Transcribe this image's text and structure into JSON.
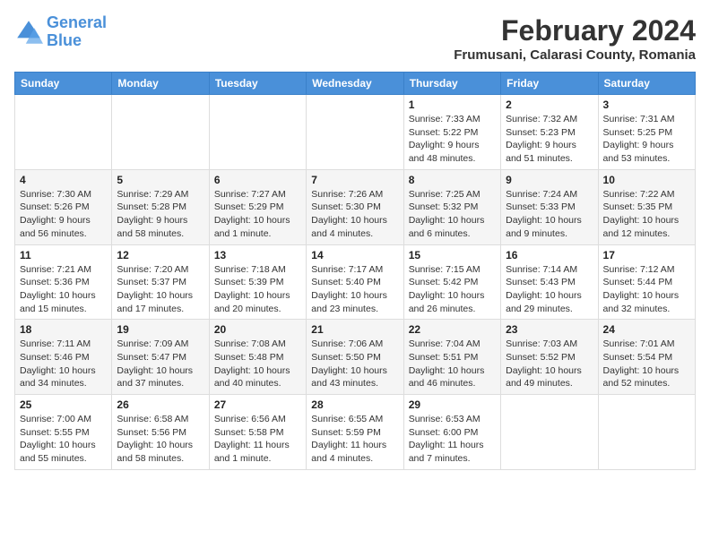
{
  "logo": {
    "line1": "General",
    "line2": "Blue"
  },
  "title": "February 2024",
  "subtitle": "Frumusani, Calarasi County, Romania",
  "days_header": [
    "Sunday",
    "Monday",
    "Tuesday",
    "Wednesday",
    "Thursday",
    "Friday",
    "Saturday"
  ],
  "weeks": [
    [
      {
        "num": "",
        "info": ""
      },
      {
        "num": "",
        "info": ""
      },
      {
        "num": "",
        "info": ""
      },
      {
        "num": "",
        "info": ""
      },
      {
        "num": "1",
        "info": "Sunrise: 7:33 AM\nSunset: 5:22 PM\nDaylight: 9 hours\nand 48 minutes."
      },
      {
        "num": "2",
        "info": "Sunrise: 7:32 AM\nSunset: 5:23 PM\nDaylight: 9 hours\nand 51 minutes."
      },
      {
        "num": "3",
        "info": "Sunrise: 7:31 AM\nSunset: 5:25 PM\nDaylight: 9 hours\nand 53 minutes."
      }
    ],
    [
      {
        "num": "4",
        "info": "Sunrise: 7:30 AM\nSunset: 5:26 PM\nDaylight: 9 hours\nand 56 minutes."
      },
      {
        "num": "5",
        "info": "Sunrise: 7:29 AM\nSunset: 5:28 PM\nDaylight: 9 hours\nand 58 minutes."
      },
      {
        "num": "6",
        "info": "Sunrise: 7:27 AM\nSunset: 5:29 PM\nDaylight: 10 hours\nand 1 minute."
      },
      {
        "num": "7",
        "info": "Sunrise: 7:26 AM\nSunset: 5:30 PM\nDaylight: 10 hours\nand 4 minutes."
      },
      {
        "num": "8",
        "info": "Sunrise: 7:25 AM\nSunset: 5:32 PM\nDaylight: 10 hours\nand 6 minutes."
      },
      {
        "num": "9",
        "info": "Sunrise: 7:24 AM\nSunset: 5:33 PM\nDaylight: 10 hours\nand 9 minutes."
      },
      {
        "num": "10",
        "info": "Sunrise: 7:22 AM\nSunset: 5:35 PM\nDaylight: 10 hours\nand 12 minutes."
      }
    ],
    [
      {
        "num": "11",
        "info": "Sunrise: 7:21 AM\nSunset: 5:36 PM\nDaylight: 10 hours\nand 15 minutes."
      },
      {
        "num": "12",
        "info": "Sunrise: 7:20 AM\nSunset: 5:37 PM\nDaylight: 10 hours\nand 17 minutes."
      },
      {
        "num": "13",
        "info": "Sunrise: 7:18 AM\nSunset: 5:39 PM\nDaylight: 10 hours\nand 20 minutes."
      },
      {
        "num": "14",
        "info": "Sunrise: 7:17 AM\nSunset: 5:40 PM\nDaylight: 10 hours\nand 23 minutes."
      },
      {
        "num": "15",
        "info": "Sunrise: 7:15 AM\nSunset: 5:42 PM\nDaylight: 10 hours\nand 26 minutes."
      },
      {
        "num": "16",
        "info": "Sunrise: 7:14 AM\nSunset: 5:43 PM\nDaylight: 10 hours\nand 29 minutes."
      },
      {
        "num": "17",
        "info": "Sunrise: 7:12 AM\nSunset: 5:44 PM\nDaylight: 10 hours\nand 32 minutes."
      }
    ],
    [
      {
        "num": "18",
        "info": "Sunrise: 7:11 AM\nSunset: 5:46 PM\nDaylight: 10 hours\nand 34 minutes."
      },
      {
        "num": "19",
        "info": "Sunrise: 7:09 AM\nSunset: 5:47 PM\nDaylight: 10 hours\nand 37 minutes."
      },
      {
        "num": "20",
        "info": "Sunrise: 7:08 AM\nSunset: 5:48 PM\nDaylight: 10 hours\nand 40 minutes."
      },
      {
        "num": "21",
        "info": "Sunrise: 7:06 AM\nSunset: 5:50 PM\nDaylight: 10 hours\nand 43 minutes."
      },
      {
        "num": "22",
        "info": "Sunrise: 7:04 AM\nSunset: 5:51 PM\nDaylight: 10 hours\nand 46 minutes."
      },
      {
        "num": "23",
        "info": "Sunrise: 7:03 AM\nSunset: 5:52 PM\nDaylight: 10 hours\nand 49 minutes."
      },
      {
        "num": "24",
        "info": "Sunrise: 7:01 AM\nSunset: 5:54 PM\nDaylight: 10 hours\nand 52 minutes."
      }
    ],
    [
      {
        "num": "25",
        "info": "Sunrise: 7:00 AM\nSunset: 5:55 PM\nDaylight: 10 hours\nand 55 minutes."
      },
      {
        "num": "26",
        "info": "Sunrise: 6:58 AM\nSunset: 5:56 PM\nDaylight: 10 hours\nand 58 minutes."
      },
      {
        "num": "27",
        "info": "Sunrise: 6:56 AM\nSunset: 5:58 PM\nDaylight: 11 hours\nand 1 minute."
      },
      {
        "num": "28",
        "info": "Sunrise: 6:55 AM\nSunset: 5:59 PM\nDaylight: 11 hours\nand 4 minutes."
      },
      {
        "num": "29",
        "info": "Sunrise: 6:53 AM\nSunset: 6:00 PM\nDaylight: 11 hours\nand 7 minutes."
      },
      {
        "num": "",
        "info": ""
      },
      {
        "num": "",
        "info": ""
      }
    ]
  ]
}
